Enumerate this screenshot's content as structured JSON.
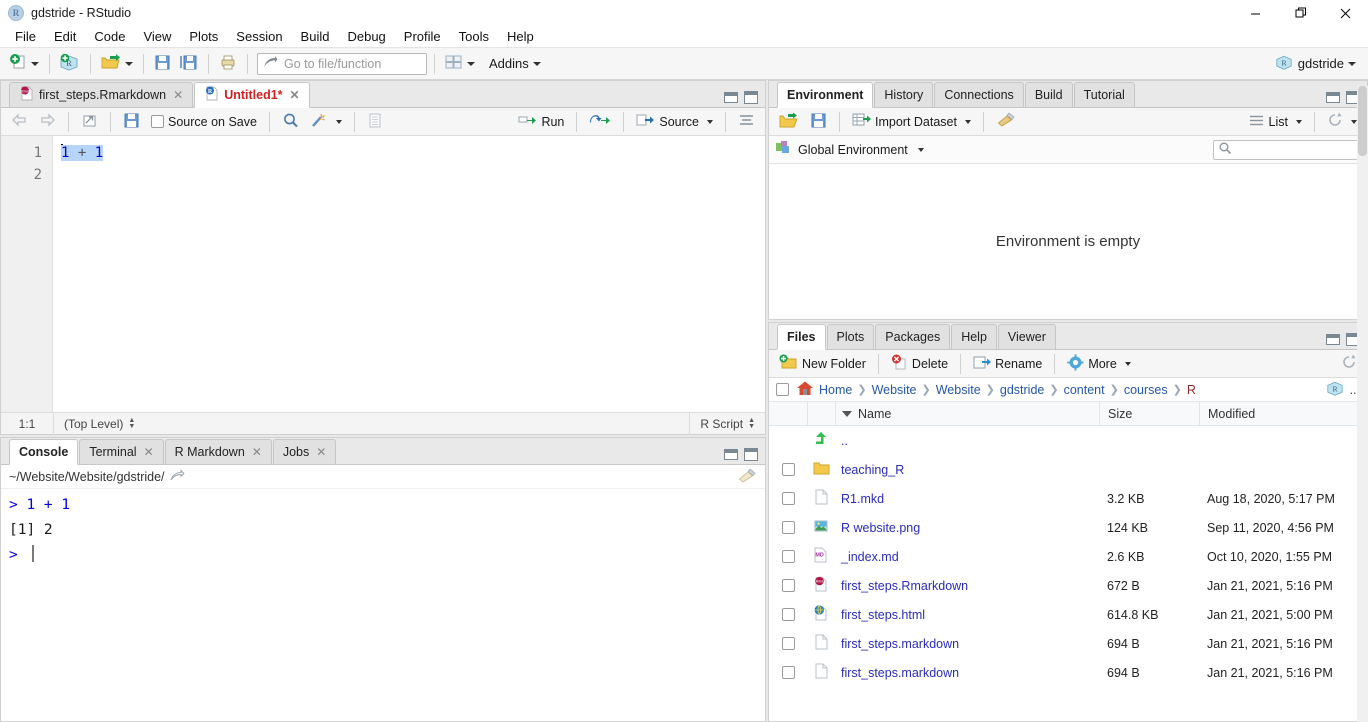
{
  "window": {
    "title": "gdstride - RStudio",
    "app_icon": "R",
    "minimize": "—",
    "maximize": "❐",
    "close": "✕"
  },
  "menubar": {
    "items": [
      "File",
      "Edit",
      "Code",
      "View",
      "Plots",
      "Session",
      "Build",
      "Debug",
      "Profile",
      "Tools",
      "Help"
    ]
  },
  "toolbar": {
    "new_file_icon": "new-file-icon",
    "new_project_icon": "new-project-icon",
    "open_file_icon": "open-file-icon",
    "save_icon": "save-icon",
    "save_all_icon": "save-all-icon",
    "print_icon": "print-icon",
    "goto_placeholder": "Go to file/function",
    "panes_icon": "panes-layout-icon",
    "addins_label": "Addins",
    "project_label": "gdstride"
  },
  "source_pane": {
    "tabs": [
      {
        "label": "first_steps.Rmarkdown",
        "icon": "rmd-file-icon",
        "active": false,
        "closable": true,
        "modified": false
      },
      {
        "label": "Untitled1*",
        "icon": "r-file-icon",
        "active": true,
        "closable": true,
        "modified": true
      }
    ],
    "toolbar": {
      "back_icon": "arrow-left-icon",
      "forward_icon": "arrow-right-icon",
      "popout_icon": "show-in-new-window-icon",
      "save_icon": "save-icon",
      "source_on_save_label": "Source on Save",
      "source_on_save_checked": false,
      "find_icon": "magnifier-icon",
      "wand_icon": "code-tools-icon",
      "compile_report_icon": "compile-report-icon",
      "run_label": "Run",
      "rerun_icon": "re-run-icon",
      "source_label": "Source",
      "outline_icon": "document-outline-icon"
    },
    "gutter": [
      "1",
      "2"
    ],
    "code_line": "1 + 1",
    "code_tokens": [
      {
        "text": "1",
        "type": "number"
      },
      {
        "text": " + ",
        "type": "operator"
      },
      {
        "text": "1",
        "type": "number"
      }
    ],
    "selection_active": true,
    "status": {
      "cursor_position": "1:1",
      "scope": "(Top Level)",
      "file_type": "R Script"
    }
  },
  "console_pane": {
    "tabs": [
      {
        "label": "Console",
        "active": true,
        "closable": false
      },
      {
        "label": "Terminal",
        "active": false,
        "closable": true
      },
      {
        "label": "R Markdown",
        "active": false,
        "closable": true
      },
      {
        "label": "Jobs",
        "active": false,
        "closable": true
      }
    ],
    "working_directory": "~/Website/Website/gdstride/",
    "popout_icon": "open-in-new-icon",
    "clear_icon": "broom-icon",
    "lines": [
      {
        "prompt": "> ",
        "text": "1 + 1",
        "color": "blue"
      },
      {
        "prompt": "",
        "text": "[1] 2",
        "color": "black"
      },
      {
        "prompt": "> ",
        "text": "",
        "color": "blue"
      }
    ]
  },
  "environment_pane": {
    "tabs": [
      {
        "label": "Environment",
        "active": true
      },
      {
        "label": "History",
        "active": false
      },
      {
        "label": "Connections",
        "active": false
      },
      {
        "label": "Build",
        "active": false
      },
      {
        "label": "Tutorial",
        "active": false
      }
    ],
    "toolbar": {
      "load_workspace_icon": "open-folder-icon",
      "save_workspace_icon": "save-icon",
      "import_dataset_label": "Import Dataset",
      "clear_icon": "broom-icon",
      "view_mode_label": "List",
      "view_mode_icon": "list-icon",
      "refresh_icon": "refresh-icon"
    },
    "scope_label": "Global Environment",
    "scope_icon": "environment-cube-icon",
    "search_placeholder": "",
    "search_icon": "search-icon",
    "empty_message": "Environment is empty"
  },
  "files_pane": {
    "tabs": [
      {
        "label": "Files",
        "active": true
      },
      {
        "label": "Plots",
        "active": false
      },
      {
        "label": "Packages",
        "active": false
      },
      {
        "label": "Help",
        "active": false
      },
      {
        "label": "Viewer",
        "active": false
      }
    ],
    "toolbar": {
      "new_folder_label": "New Folder",
      "new_folder_icon": "new-folder-icon",
      "delete_label": "Delete",
      "delete_icon": "delete-icon",
      "rename_label": "Rename",
      "rename_icon": "rename-icon",
      "more_label": "More",
      "more_icon": "gear-icon",
      "refresh_icon": "refresh-icon"
    },
    "breadcrumb": {
      "home_icon": "home-icon",
      "crumbs": [
        "Home",
        "Website",
        "Website",
        "gdstride",
        "content",
        "courses",
        "R"
      ],
      "project_icon": "r-project-icon",
      "overflow": "..."
    },
    "columns": {
      "name": "Name",
      "size": "Size",
      "modified": "Modified"
    },
    "sort": {
      "column": "Name",
      "direction": "descending"
    },
    "rows": [
      {
        "icon": "up-arrow-icon",
        "name": "..",
        "size": "",
        "modified": "",
        "checkbox": false
      },
      {
        "icon": "folder-icon",
        "name": "teaching_R",
        "size": "",
        "modified": "",
        "checkbox": true
      },
      {
        "icon": "blank-file-icon",
        "name": "R1.mkd",
        "size": "3.2 KB",
        "modified": "Aug 18, 2020, 5:17 PM",
        "checkbox": true
      },
      {
        "icon": "image-file-icon",
        "name": "R website.png",
        "size": "124 KB",
        "modified": "Sep 11, 2020, 4:56 PM",
        "checkbox": true
      },
      {
        "icon": "md-file-icon",
        "name": "_index.md",
        "size": "2.6 KB",
        "modified": "Oct 10, 2020, 1:55 PM",
        "checkbox": true
      },
      {
        "icon": "rmd-file-icon",
        "name": "first_steps.Rmarkdown",
        "size": "672 B",
        "modified": "Jan 21, 2021, 5:16 PM",
        "checkbox": true
      },
      {
        "icon": "html-file-icon",
        "name": "first_steps.html",
        "size": "614.8 KB",
        "modified": "Jan 21, 2021, 5:00 PM",
        "checkbox": true
      },
      {
        "icon": "blank-file-icon",
        "name": "first_steps.markdown",
        "size": "694 B",
        "modified": "Jan 21, 2021, 5:16 PM",
        "checkbox": true
      },
      {
        "icon": "blank-file-icon",
        "name": "first_steps.markdown",
        "size": "694 B",
        "modified": "Jan 21, 2021, 5:16 PM",
        "checkbox": true
      }
    ]
  },
  "colors": {
    "accent_blue": "#2457a8",
    "link_blue": "#2b2bb8",
    "code_blue": "#0000d0",
    "selection": "#b5d5fb",
    "modified_red": "#cf2020",
    "pane_bg": "#f6f6f6"
  }
}
